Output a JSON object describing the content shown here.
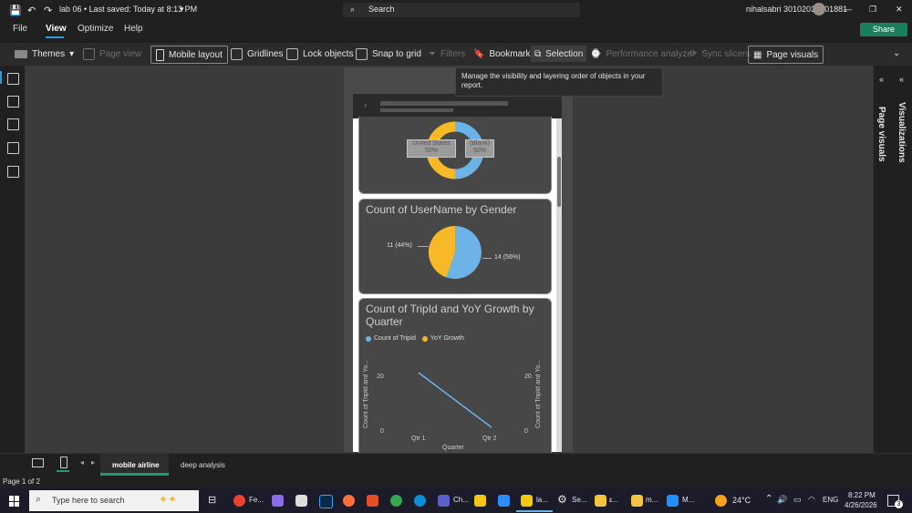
{
  "titlebar": {
    "file_info": "lab 06 • Last saved: Today at 8:13 PM",
    "search_placeholder": "Search",
    "user": "nihalsabri 30102032601881"
  },
  "menu": {
    "file": "File",
    "view": "View",
    "optimize": "Optimize",
    "help": "Help",
    "share": "Share"
  },
  "ribbon": {
    "themes": "Themes",
    "page_view": "Page view",
    "mobile_layout": "Mobile layout",
    "gridlines": "Gridlines",
    "lock_objects": "Lock objects",
    "snap_to_grid": "Snap to grid",
    "filters": "Filters",
    "bookmarks": "Bookmarks",
    "selection": "Selection",
    "performance_analyzer": "Performance analyzer",
    "sync_slicers": "Sync slicers",
    "page_visuals": "Page visuals"
  },
  "tooltip": "Manage the visibility and layering order of objects in your report.",
  "right_panel": {
    "page_visuals": "Page visuals",
    "visualizations": "Visualizations"
  },
  "donut": {
    "label_left": "United States",
    "pct_left": "50%",
    "label_right": "(Blank)",
    "pct_right": "50%"
  },
  "pie_card": {
    "title": "Count of UserName by Gender",
    "left_label": "11 (44%)",
    "right_label": "14 (56%)"
  },
  "line_card": {
    "title": "Count of TripId and YoY Growth by Quarter",
    "legend1": "Count of TripId",
    "legend2": "YoY Growth",
    "y_left_label": "Count of TripId and Yo...",
    "y_right_label": "Count of TripId and Yo...",
    "tick20": "20",
    "tick0": "0",
    "xlabel": "Quarter",
    "x1": "Qtr 1",
    "x2": "Qtr 2"
  },
  "colors": {
    "blue": "#6cb4e8",
    "yellow": "#f7b928",
    "share_green": "#1a7f5a"
  },
  "tabs": {
    "tab1": "mobile airline",
    "tab2": "deep analysis"
  },
  "status": {
    "page": "Page 1 of 2"
  },
  "taskbar": {
    "search_placeholder": "Type here to search",
    "app_fe": "Fe...",
    "app_ch": "Ch...",
    "app_la": "la...",
    "app_se": "Se...",
    "app_e": "ε...",
    "app_m": "m...",
    "app_M": "M...",
    "temp": "24°C",
    "lang": "ENG",
    "time": "8:22 PM",
    "date": "4/26/2026",
    "notif": "3"
  }
}
